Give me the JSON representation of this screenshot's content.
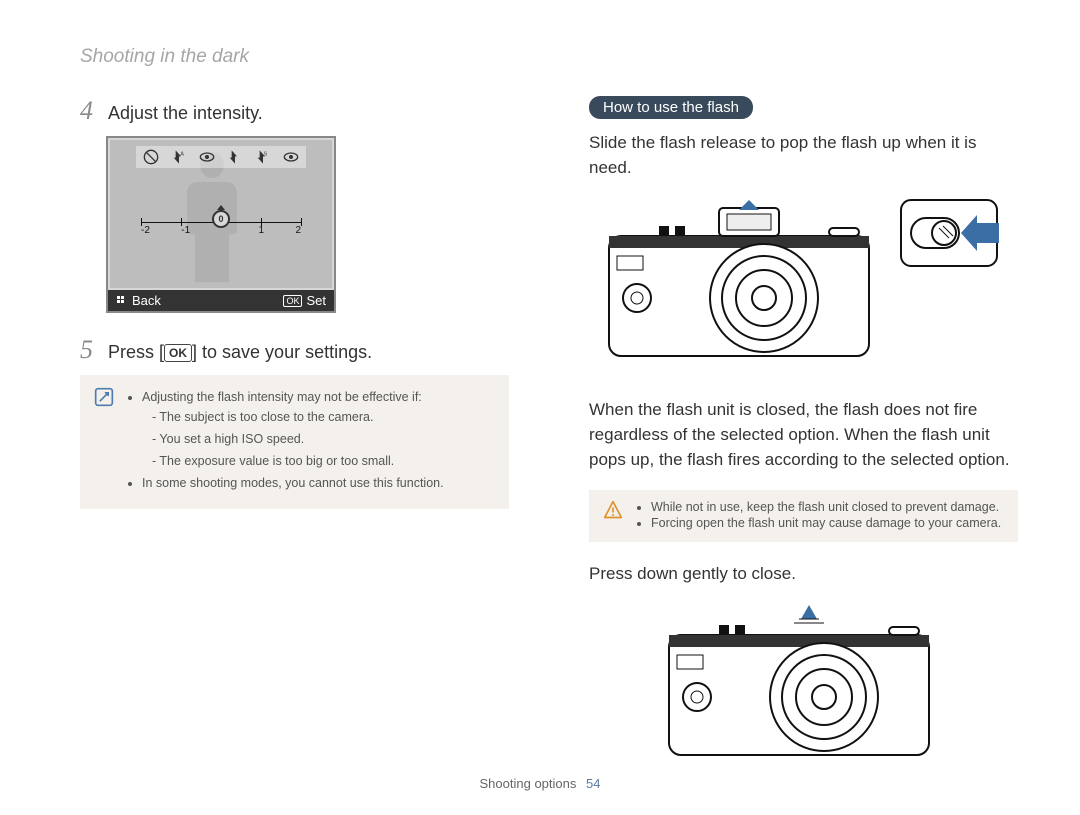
{
  "header": {
    "breadcrumb": "Shooting in the dark"
  },
  "left": {
    "step4": {
      "num": "4",
      "text": "Adjust the intensity."
    },
    "lcd": {
      "scale": {
        "labels": [
          "-2",
          "-1",
          "0",
          "1",
          "2"
        ],
        "selected": "0"
      },
      "bar": {
        "back": "Back",
        "set": "Set",
        "ok": "OK"
      }
    },
    "step5": {
      "num": "5",
      "pre": "Press [",
      "ok": "OK",
      "post": "] to save your settings."
    },
    "note": {
      "bullets": [
        "Adjusting the flash intensity may not be effective if:",
        "In some shooting modes, you cannot use this function."
      ],
      "sub": [
        "The subject is too close to the camera.",
        "You set a high ISO speed.",
        "The exposure value is too big or too small."
      ]
    }
  },
  "right": {
    "pill": "How to use the flash",
    "p1": "Slide the flash release to pop the flash up when it is need.",
    "p2": "When the flash unit is closed, the flash does not fire regardless of the selected option. When the flash unit pops up, the flash fires according to the selected option.",
    "warn": [
      "While not in use, keep the flash unit closed to prevent damage.",
      "Forcing open the flash unit may cause damage to your camera."
    ],
    "p3": "Press down gently to close."
  },
  "footer": {
    "section": "Shooting options",
    "page": "54"
  }
}
